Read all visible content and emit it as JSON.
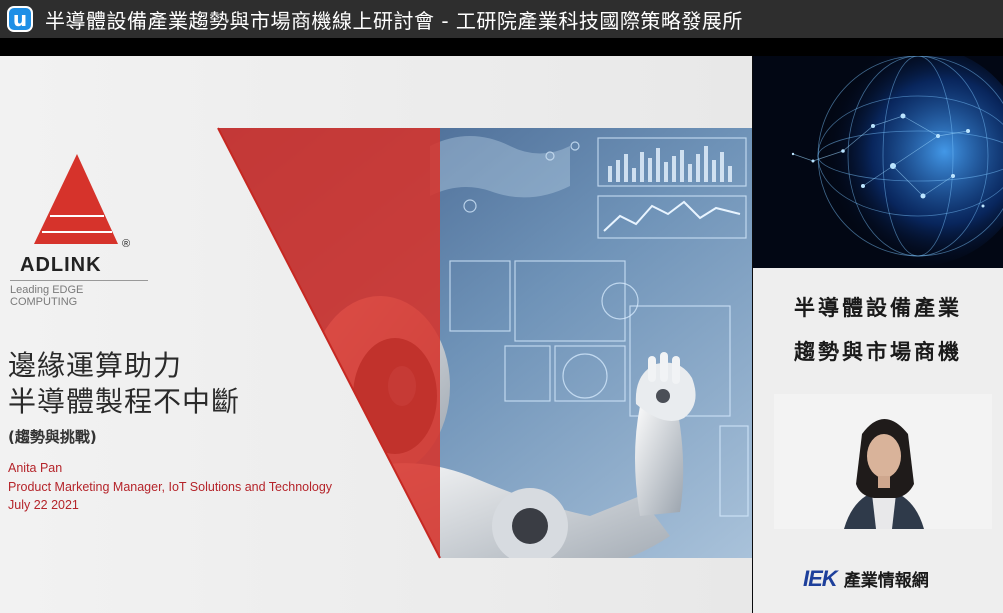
{
  "window": {
    "app_icon_glyph": "u",
    "title": "半導體設備產業趨勢與市場商機線上研討會 - 工研院產業科技國際策略發展所"
  },
  "slide": {
    "logo_text": "ADLINK",
    "logo_registered": "®",
    "logo_tagline": "Leading EDGE COMPUTING",
    "title_line1": "邊緣運算助力",
    "title_line2": "半導體製程不中斷",
    "subtitle": "(趨勢與挑戰)",
    "presenter_name": "Anita Pan",
    "presenter_role": "Product Marketing Manager, IoT Solutions and Technology",
    "date": "July 22 2021"
  },
  "side_panel": {
    "event_title_line1": "半導體設備產業",
    "event_title_line2": "趨勢與市場商機",
    "brand_mark": "IEK",
    "brand_name": "產業情報網"
  },
  "colors": {
    "adlink_red": "#d6332b",
    "presenter_red": "#b5242a",
    "iek_blue": "#1d3f9b",
    "titlebar": "#2e2e2e"
  },
  "icons": {
    "app": "app-logo-icon",
    "globe": "globe-network-image",
    "robot": "robot-hand-image"
  }
}
